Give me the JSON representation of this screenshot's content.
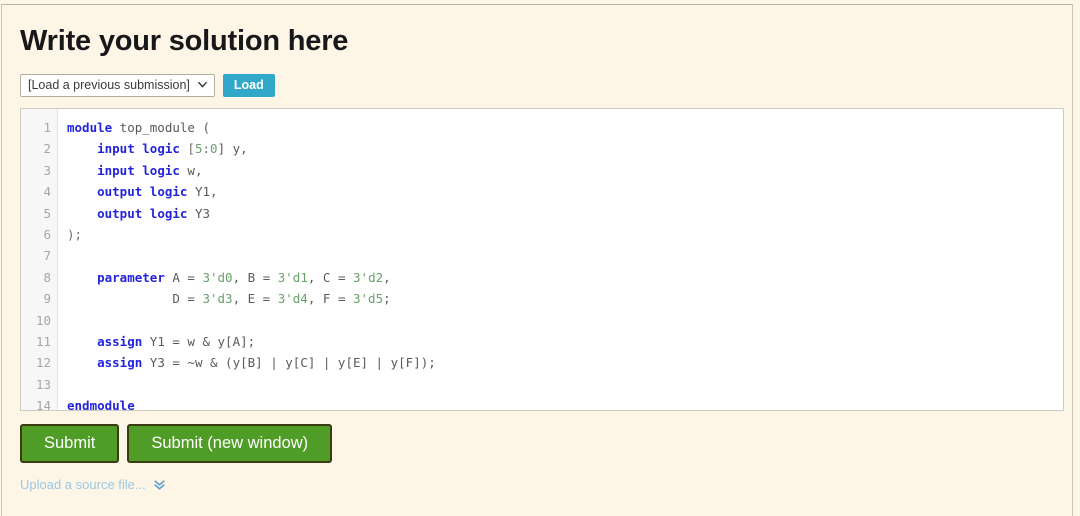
{
  "page": {
    "title": "Write your solution here",
    "background_color": "#fdf6e7"
  },
  "load_row": {
    "select": {
      "selected_value": "[Load a previous submission]",
      "icon": "chevron-down-icon"
    },
    "load_button": {
      "label": "Load",
      "color": "#31a8c9"
    }
  },
  "editor": {
    "language": "verilog",
    "background_color": "#ffffff",
    "gutter_color": "#f7f7f7",
    "keyword_color": "#2323dd",
    "literal_color": "#6aa06a",
    "line_numbers": [
      "1",
      "2",
      "3",
      "4",
      "5",
      "6",
      "7",
      "8",
      "9",
      "10",
      "11",
      "12",
      "13",
      "14"
    ],
    "lines": [
      [
        {
          "t": "module",
          "c": "kw"
        },
        {
          "t": " top_module (",
          "c": "id"
        }
      ],
      [
        {
          "t": "    ",
          "c": "id"
        },
        {
          "t": "input logic",
          "c": "kw"
        },
        {
          "t": " [",
          "c": "punc"
        },
        {
          "t": "5",
          "c": "num"
        },
        {
          "t": ":",
          "c": "punc"
        },
        {
          "t": "0",
          "c": "num"
        },
        {
          "t": "] y,",
          "c": "id"
        }
      ],
      [
        {
          "t": "    ",
          "c": "id"
        },
        {
          "t": "input logic",
          "c": "kw"
        },
        {
          "t": " w,",
          "c": "id"
        }
      ],
      [
        {
          "t": "    ",
          "c": "id"
        },
        {
          "t": "output logic",
          "c": "kw"
        },
        {
          "t": " Y1,",
          "c": "id"
        }
      ],
      [
        {
          "t": "    ",
          "c": "id"
        },
        {
          "t": "output logic",
          "c": "kw"
        },
        {
          "t": " Y3",
          "c": "id"
        }
      ],
      [
        {
          "t": ");",
          "c": "punc"
        }
      ],
      [
        {
          "t": "",
          "c": "id"
        }
      ],
      [
        {
          "t": "    ",
          "c": "id"
        },
        {
          "t": "parameter",
          "c": "kw"
        },
        {
          "t": " A = ",
          "c": "id"
        },
        {
          "t": "3'd0",
          "c": "num"
        },
        {
          "t": ", B = ",
          "c": "id"
        },
        {
          "t": "3'd1",
          "c": "num"
        },
        {
          "t": ", C = ",
          "c": "id"
        },
        {
          "t": "3'd2",
          "c": "num"
        },
        {
          "t": ",",
          "c": "id"
        }
      ],
      [
        {
          "t": "              D = ",
          "c": "id"
        },
        {
          "t": "3'd3",
          "c": "num"
        },
        {
          "t": ", E = ",
          "c": "id"
        },
        {
          "t": "3'd4",
          "c": "num"
        },
        {
          "t": ", F = ",
          "c": "id"
        },
        {
          "t": "3'd5",
          "c": "num"
        },
        {
          "t": ";",
          "c": "id"
        }
      ],
      [
        {
          "t": "",
          "c": "id"
        }
      ],
      [
        {
          "t": "    ",
          "c": "id"
        },
        {
          "t": "assign",
          "c": "kw"
        },
        {
          "t": " Y1 = w & y[A];",
          "c": "id"
        }
      ],
      [
        {
          "t": "    ",
          "c": "id"
        },
        {
          "t": "assign",
          "c": "kw"
        },
        {
          "t": " Y3 = ~w & (y[B] | y[C] | y[E] | y[F]);",
          "c": "id"
        }
      ],
      [
        {
          "t": "",
          "c": "id"
        }
      ],
      [
        {
          "t": "endmodule",
          "c": "kw"
        }
      ]
    ],
    "plain_text": "module top_module (\n    input logic [5:0] y,\n    input logic w,\n    output logic Y1,\n    output logic Y3\n);\n\n    parameter A = 3'd0, B = 3'd1, C = 3'd2,\n              D = 3'd3, E = 3'd4, F = 3'd5;\n\n    assign Y1 = w & y[A];\n    assign Y3 = ~w & (y[B] | y[C] | y[E] | y[F]);\n\nendmodule"
  },
  "actions": {
    "submit_label": "Submit",
    "submit_new_window_label": "Submit (new window)",
    "button_color": "#4f9c26"
  },
  "upload": {
    "label": "Upload a source file...",
    "icon": "double-chevron-down-icon",
    "color": "#9cc8e4"
  }
}
